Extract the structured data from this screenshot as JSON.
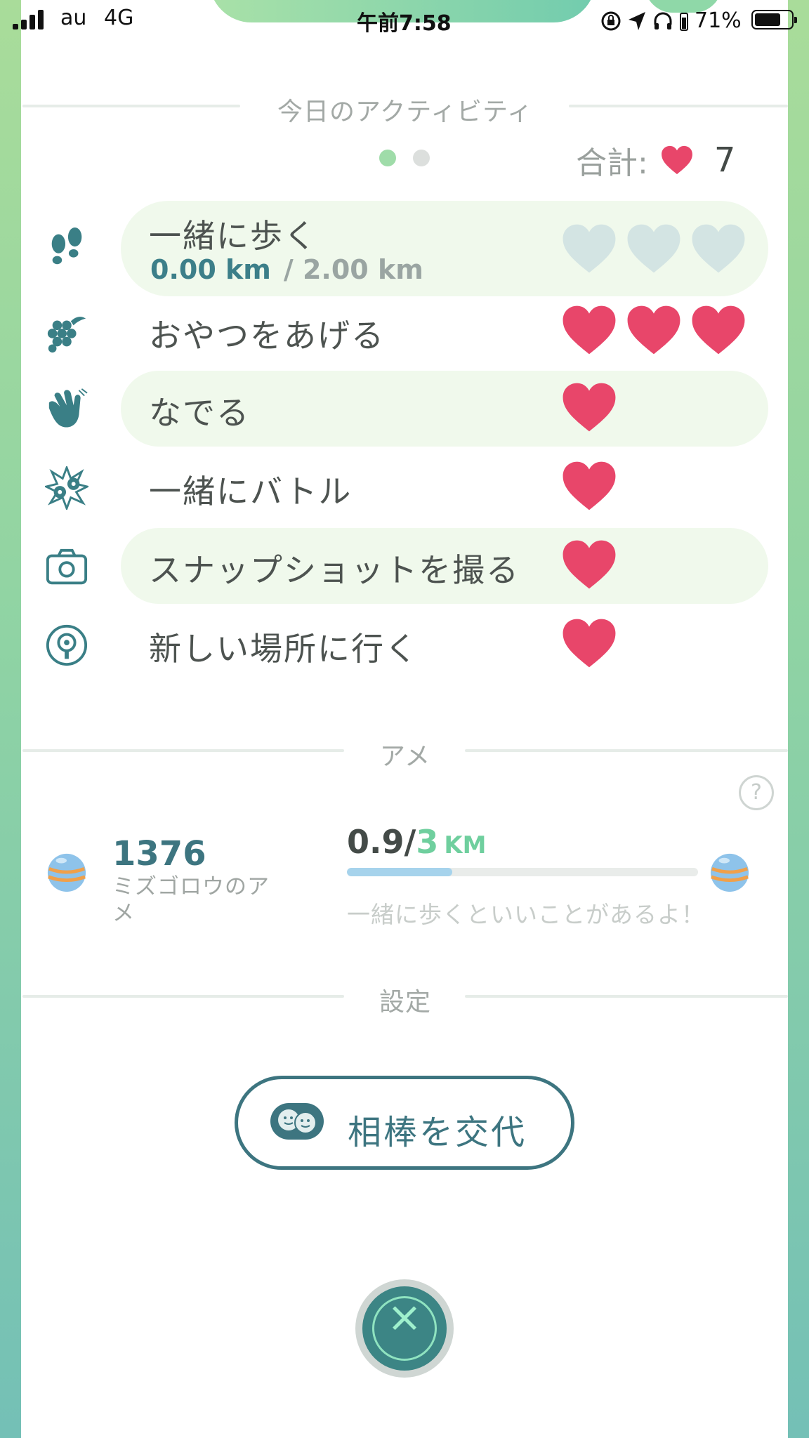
{
  "status_bar": {
    "carrier": "au",
    "network": "4G",
    "time": "午前7:58",
    "battery": "71%"
  },
  "activities": {
    "title": "今日のアクティビティ",
    "total_label": "合計:",
    "total_value": "7",
    "items": [
      {
        "name": "walk",
        "label": "一緒に歩く",
        "current_km": "0.00 km",
        "goal_km": "/ 2.00 km",
        "hearts_earned": 0,
        "hearts_max": 3
      },
      {
        "name": "treat",
        "label": "おやつをあげる",
        "hearts_earned": 3,
        "hearts_max": 3
      },
      {
        "name": "pet",
        "label": "なでる",
        "hearts_earned": 1,
        "hearts_max": 1
      },
      {
        "name": "battle",
        "label": "一緒にバトル",
        "hearts_earned": 1,
        "hearts_max": 1
      },
      {
        "name": "snapshot",
        "label": "スナップショットを撮る",
        "hearts_earned": 1,
        "hearts_max": 1
      },
      {
        "name": "visit",
        "label": "新しい場所に行く",
        "hearts_earned": 1,
        "hearts_max": 1
      }
    ]
  },
  "candy": {
    "title": "アメ",
    "count": "1376",
    "name": "ミズゴロウのアメ",
    "distance": "0.9",
    "slash": "/",
    "goal": "3",
    "unit": "KM",
    "progress": 0.3,
    "hint": "一緒に歩くといいことがあるよ！"
  },
  "settings": {
    "title": "設定",
    "swap_label": "相棒を交代"
  },
  "colors": {
    "heart": "#e8466a",
    "heart_empty": "#d3e4e3",
    "accent": "#3d7580",
    "row_bg": "#f0f9ec"
  }
}
